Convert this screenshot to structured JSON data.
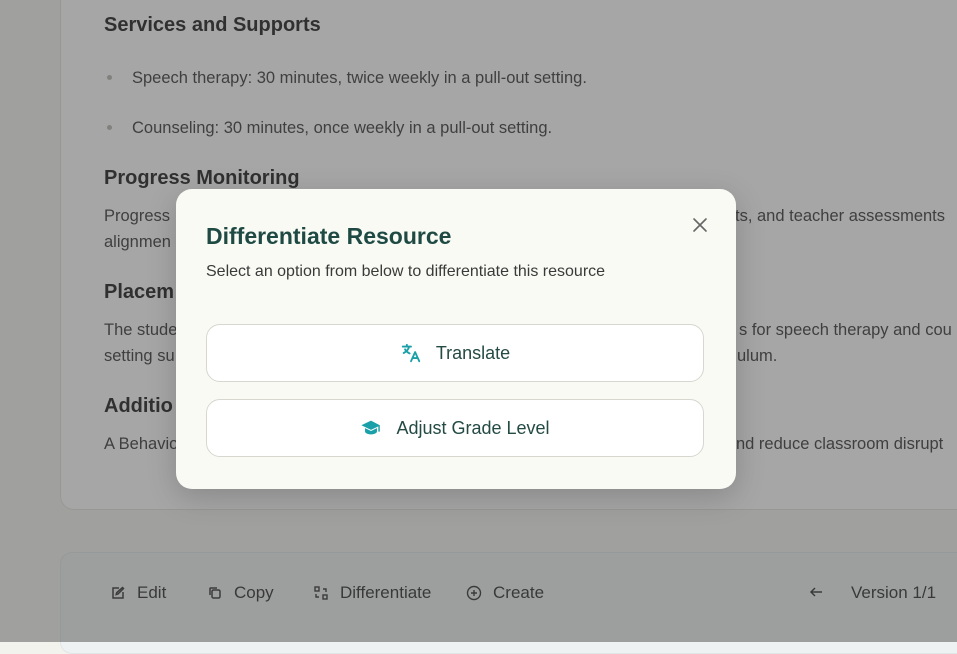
{
  "document": {
    "services_heading": "Services and Supports",
    "services_items": [
      "Speech therapy: 30 minutes, twice weekly in a pull-out setting.",
      "Counseling: 30 minutes, once weekly in a pull-out setting."
    ],
    "progress_heading": "Progress Monitoring",
    "progress_line1_start": "Progress",
    "progress_line1_end": "ts, and teacher assessments",
    "progress_line2_start": "alignmen",
    "placement_heading_partial": "Placem",
    "placement_line1_start": "The stude",
    "placement_line1_end": "s for speech therapy and cou",
    "placement_line2_start": "setting su",
    "placement_line2_end": "ulum.",
    "additional_heading_partial": "Additio",
    "additional_line1_start": "A Behavio",
    "additional_line1_end": "nd reduce classroom disrupt"
  },
  "toolbar": {
    "edit_label": "Edit",
    "copy_label": "Copy",
    "differentiate_label": "Differentiate",
    "create_label": "Create",
    "version_label": "Version 1/1"
  },
  "modal": {
    "title": "Differentiate Resource",
    "subtitle": "Select an option from below to differentiate this resource",
    "translate_label": "Translate",
    "adjust_grade_label": "Adjust Grade Level"
  },
  "colors": {
    "accent_teal": "#1aa0a8",
    "title_green": "#1f4a44"
  }
}
